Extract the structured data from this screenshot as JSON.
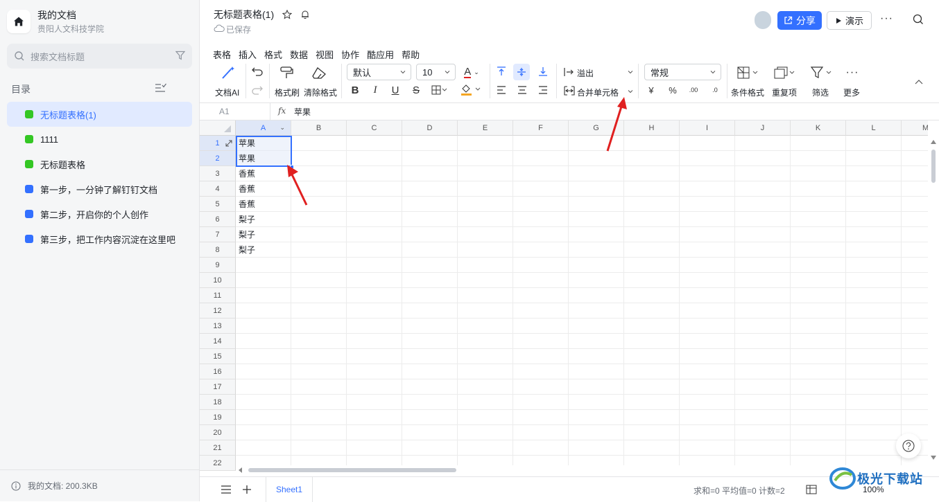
{
  "sidebar": {
    "workspace_name": "我的文档",
    "workspace_org": "贵阳人文科技学院",
    "search_placeholder": "搜索文档标题",
    "toc_title": "目录",
    "items": [
      {
        "label": "无标题表格(1)",
        "type": "sheet",
        "active": true
      },
      {
        "label": "1111",
        "type": "sheet"
      },
      {
        "label": "无标题表格",
        "type": "sheet"
      },
      {
        "label": "第一步，一分钟了解钉钉文档",
        "type": "doc"
      },
      {
        "label": "第二步，开启你的个人创作",
        "type": "doc"
      },
      {
        "label": "第三步，把工作内容沉淀在这里吧",
        "type": "doc"
      }
    ],
    "footer": "我的文档: 200.3KB"
  },
  "header": {
    "title": "无标题表格(1)",
    "saved": "已保存",
    "share_label": "分享",
    "present_label": "演示"
  },
  "menu": [
    "表格",
    "插入",
    "格式",
    "数据",
    "视图",
    "协作",
    "酷应用",
    "帮助"
  ],
  "toolbar": {
    "ai_label": "文档AI",
    "format_painter": "格式刷",
    "clear_format": "清除格式",
    "font_family": "默认",
    "font_size": "10",
    "overflow_label": "溢出",
    "merge_label": "合并单元格",
    "number_format": "常规",
    "currency": "¥",
    "percent": "%",
    "conditional_format": "条件格式",
    "duplicates": "重复项",
    "filter": "筛选",
    "more": "更多"
  },
  "formula": {
    "cell_ref": "A1",
    "fx": "fx",
    "value": "苹果"
  },
  "columns": [
    "A",
    "B",
    "C",
    "D",
    "E",
    "F",
    "G",
    "H",
    "I",
    "J",
    "K",
    "L",
    "M"
  ],
  "rows": [
    "1",
    "2",
    "3",
    "4",
    "5",
    "6",
    "7",
    "8",
    "9",
    "10",
    "11",
    "12",
    "13",
    "14",
    "15",
    "16",
    "17",
    "18",
    "19",
    "20",
    "21",
    "22"
  ],
  "cells": [
    "苹果",
    "苹果",
    "香蕉",
    "香蕉",
    "香蕉",
    "梨子",
    "梨子",
    "梨子"
  ],
  "footer": {
    "sheet_tab": "Sheet1",
    "stats": "求和=0 平均值=0 计数=2",
    "zoom": "100%"
  },
  "watermark": "极光下载站",
  "colors": {
    "accent": "#3370ff",
    "arrow": "#e02020",
    "selection": "#dfe7f7"
  }
}
